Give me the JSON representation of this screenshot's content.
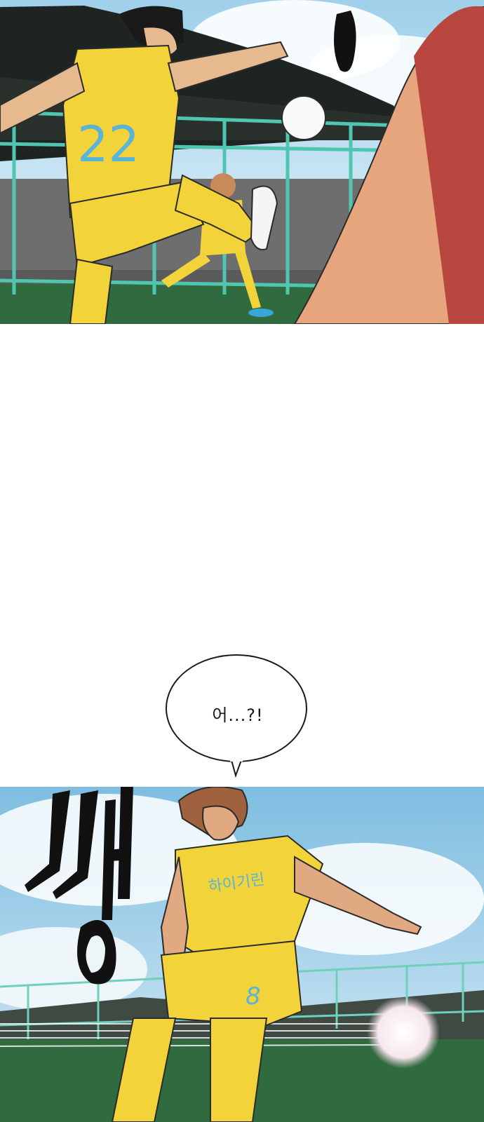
{
  "speech_bubble": {
    "text": "어...?!"
  },
  "sound_effect": {
    "text": "쌩"
  },
  "jersey": {
    "team_label": "하이기린",
    "number_back": "22",
    "number_front": "8"
  },
  "colors": {
    "jersey_yellow": "#F2D43A",
    "sky_blue": "#8EC6E4",
    "fence_teal": "#4FC7B0",
    "pitch_green": "#2F6B3E",
    "sleeve_red": "#B8473F"
  }
}
